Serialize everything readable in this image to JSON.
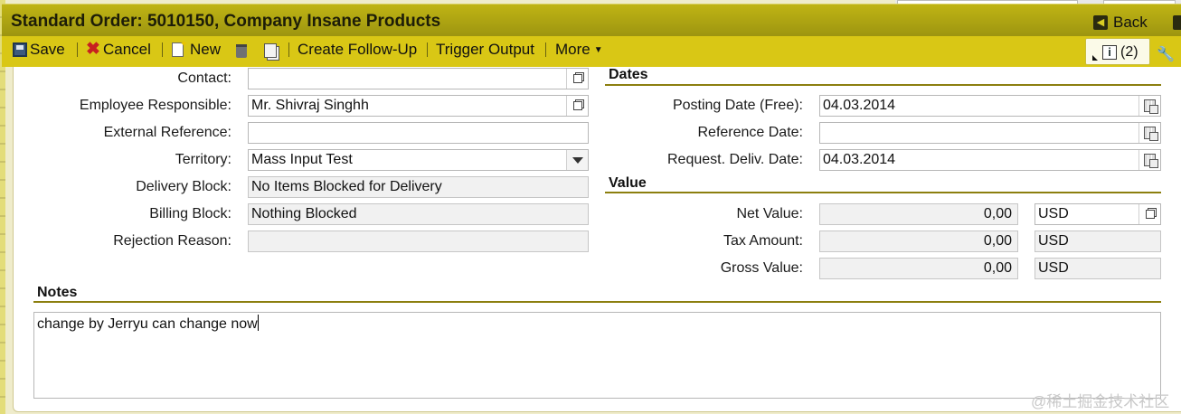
{
  "header": {
    "title": "Standard Order: 5010150, Company Insane Products",
    "back_label": "Back"
  },
  "toolbar": {
    "save_label": "Save",
    "cancel_label": "Cancel",
    "new_label": "New",
    "follow_up_label": "Create Follow-Up",
    "trigger_output_label": "Trigger Output",
    "more_label": "More",
    "info_count": "(2)"
  },
  "left_fields": {
    "contact": {
      "label": "Contact:",
      "value": ""
    },
    "employee_responsible": {
      "label": "Employee Responsible:",
      "value": "Mr. Shivraj Singhh"
    },
    "external_reference": {
      "label": "External Reference:",
      "value": ""
    },
    "territory": {
      "label": "Territory:",
      "value": "Mass Input Test"
    },
    "delivery_block": {
      "label": "Delivery Block:",
      "value": "No Items Blocked for Delivery"
    },
    "billing_block": {
      "label": "Billing Block:",
      "value": "Nothing Blocked"
    },
    "rejection_reason": {
      "label": "Rejection Reason:",
      "value": ""
    }
  },
  "dates": {
    "section_title": "Dates",
    "posting_date": {
      "label": "Posting Date (Free):",
      "value": "04.03.2014"
    },
    "reference_date": {
      "label": "Reference Date:",
      "value": ""
    },
    "request_deliv_date": {
      "label": "Request. Deliv. Date:",
      "value": "04.03.2014"
    }
  },
  "value": {
    "section_title": "Value",
    "net_value": {
      "label": "Net Value:",
      "amount": "0,00",
      "currency": "USD"
    },
    "tax_amount": {
      "label": "Tax Amount:",
      "amount": "0,00",
      "currency": "USD"
    },
    "gross_value": {
      "label": "Gross Value:",
      "amount": "0,00",
      "currency": "USD"
    }
  },
  "notes": {
    "section_title": "Notes",
    "text": "change by Jerryu can change now"
  },
  "watermark": "@稀土掘金技术社区"
}
